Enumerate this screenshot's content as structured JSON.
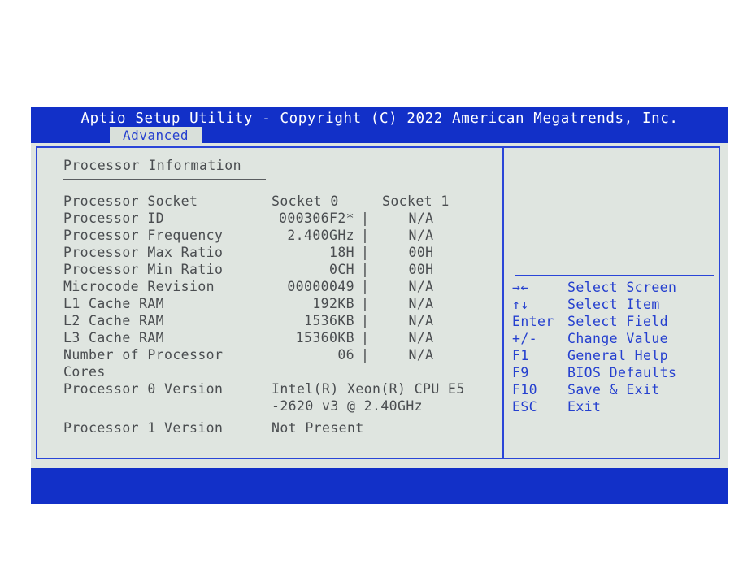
{
  "titlebar": {
    "title": "Aptio Setup Utility - Copyright (C) 2022 American Megatrends, Inc.",
    "active_tab": "Advanced"
  },
  "main": {
    "section_title": "Processor Information",
    "column_headers": {
      "label": "",
      "socket0": "Socket 0",
      "socket1": "Socket 1"
    },
    "rows": [
      {
        "label": "Processor Socket",
        "socket0": "Socket 0",
        "sep": "",
        "socket1": "Socket 1"
      },
      {
        "label": "Processor ID",
        "socket0": "000306F2*",
        "sep": "|",
        "socket1": "N/A"
      },
      {
        "label": "Processor Frequency",
        "socket0": "2.400GHz",
        "sep": "|",
        "socket1": "N/A"
      },
      {
        "label": "Processor Max Ratio",
        "socket0": "18H",
        "sep": "|",
        "socket1": "00H"
      },
      {
        "label": "Processor Min Ratio",
        "socket0": "0CH",
        "sep": "|",
        "socket1": "00H"
      },
      {
        "label": "Microcode Revision",
        "socket0": "00000049",
        "sep": "|",
        "socket1": "N/A"
      },
      {
        "label": "L1 Cache RAM",
        "socket0": "192KB",
        "sep": "|",
        "socket1": "N/A"
      },
      {
        "label": "L2 Cache RAM",
        "socket0": "1536KB",
        "sep": "|",
        "socket1": "N/A"
      },
      {
        "label": "L3 Cache RAM",
        "socket0": "15360KB",
        "sep": "|",
        "socket1": "N/A"
      },
      {
        "label": "Number of Processor",
        "socket0": "06",
        "sep": "|",
        "socket1": "N/A"
      }
    ],
    "cores_continuation": "Cores",
    "processor0": {
      "label": "Processor 0 Version",
      "value_line1": "Intel(R) Xeon(R) CPU E5",
      "value_line2": "-2620 v3 @ 2.40GHz"
    },
    "processor1": {
      "label": "Processor 1 Version",
      "value": "Not Present"
    }
  },
  "help": {
    "items": [
      {
        "key": "→←",
        "action": "Select Screen"
      },
      {
        "key": "↑↓",
        "action": "Select Item"
      },
      {
        "key": "Enter",
        "action": "Select Field"
      },
      {
        "key": "+/-",
        "action": "Change Value"
      },
      {
        "key": "F1",
        "action": "General Help"
      },
      {
        "key": "F9",
        "action": "BIOS Defaults"
      },
      {
        "key": "F10",
        "action": "Save & Exit"
      },
      {
        "key": "ESC",
        "action": "Exit"
      }
    ]
  },
  "colors": {
    "bios_blue": "#1230c8",
    "border_blue": "#2a45d8",
    "text_blue": "#2540cf",
    "screen_bg": "#dfe5e0",
    "body_text": "#4a4d50"
  }
}
